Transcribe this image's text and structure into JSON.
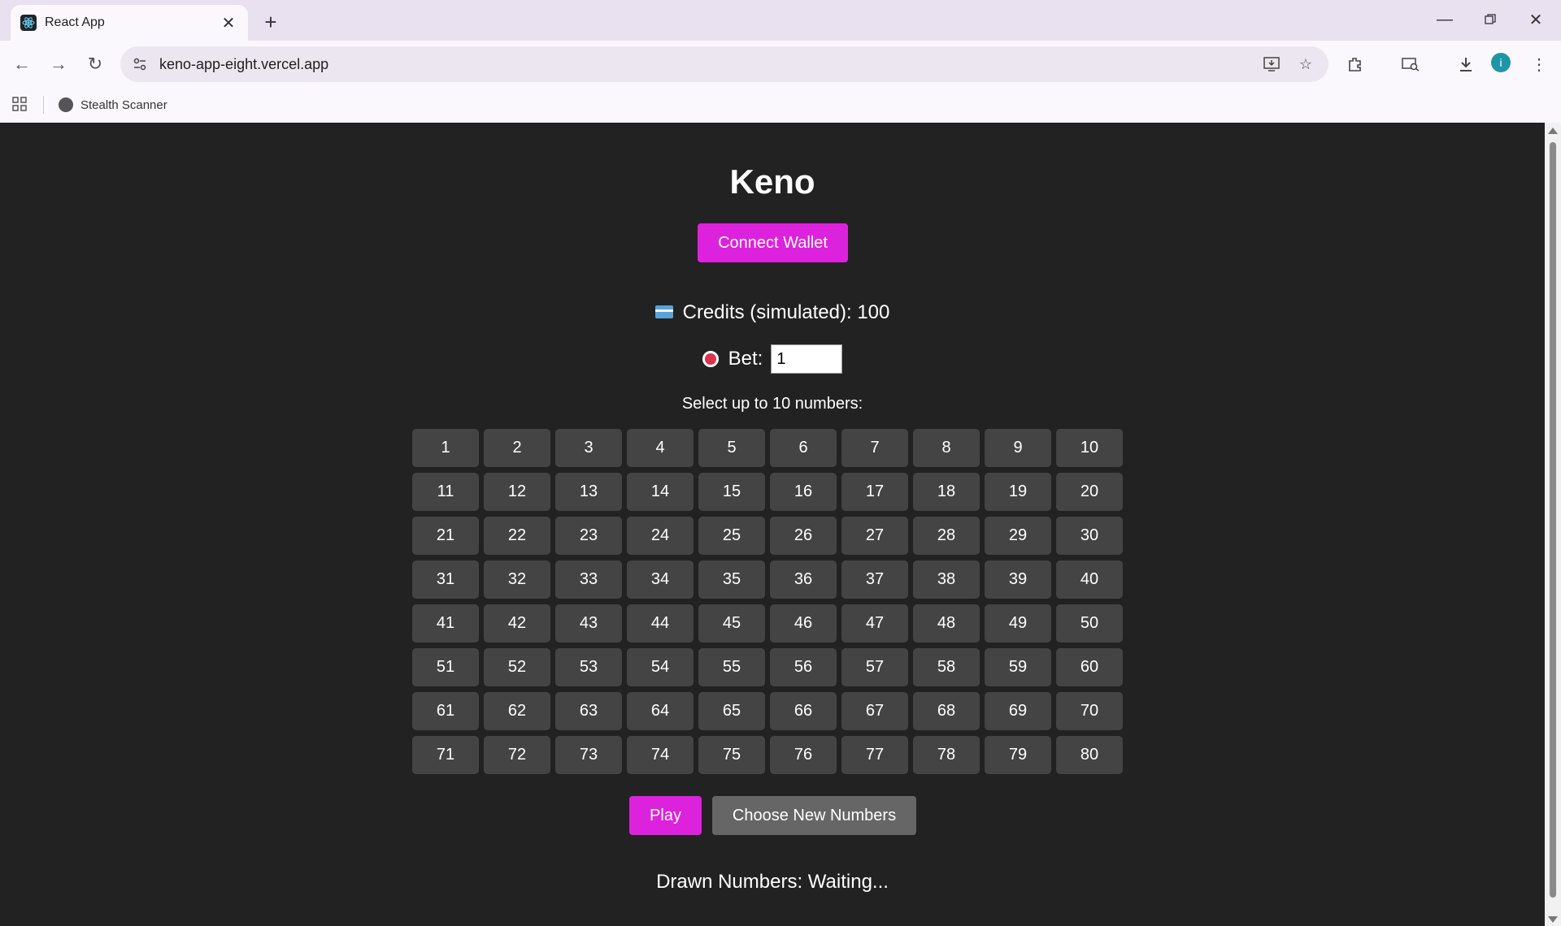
{
  "browser": {
    "tab_title": "React App",
    "url": "keno-app-eight.vercel.app",
    "bookmark_label": "Stealth Scanner",
    "profile_initial": "i"
  },
  "app": {
    "title": "Keno",
    "connect_wallet_label": "Connect Wallet",
    "credits_text": "Credits (simulated): 100",
    "bet_label": "Bet:",
    "bet_value": "1",
    "select_prompt": "Select up to 10 numbers:",
    "numbers": [
      "1",
      "2",
      "3",
      "4",
      "5",
      "6",
      "7",
      "8",
      "9",
      "10",
      "11",
      "12",
      "13",
      "14",
      "15",
      "16",
      "17",
      "18",
      "19",
      "20",
      "21",
      "22",
      "23",
      "24",
      "25",
      "26",
      "27",
      "28",
      "29",
      "30",
      "31",
      "32",
      "33",
      "34",
      "35",
      "36",
      "37",
      "38",
      "39",
      "40",
      "41",
      "42",
      "43",
      "44",
      "45",
      "46",
      "47",
      "48",
      "49",
      "50",
      "51",
      "52",
      "53",
      "54",
      "55",
      "56",
      "57",
      "58",
      "59",
      "60",
      "61",
      "62",
      "63",
      "64",
      "65",
      "66",
      "67",
      "68",
      "69",
      "70",
      "71",
      "72",
      "73",
      "74",
      "75",
      "76",
      "77",
      "78",
      "79",
      "80"
    ],
    "play_label": "Play",
    "choose_new_label": "Choose New Numbers",
    "drawn_text": "Drawn Numbers: Waiting..."
  },
  "colors": {
    "accent": "#dd22dd",
    "background": "#222222",
    "number_tile": "#444444",
    "secondary_button": "#666666"
  }
}
